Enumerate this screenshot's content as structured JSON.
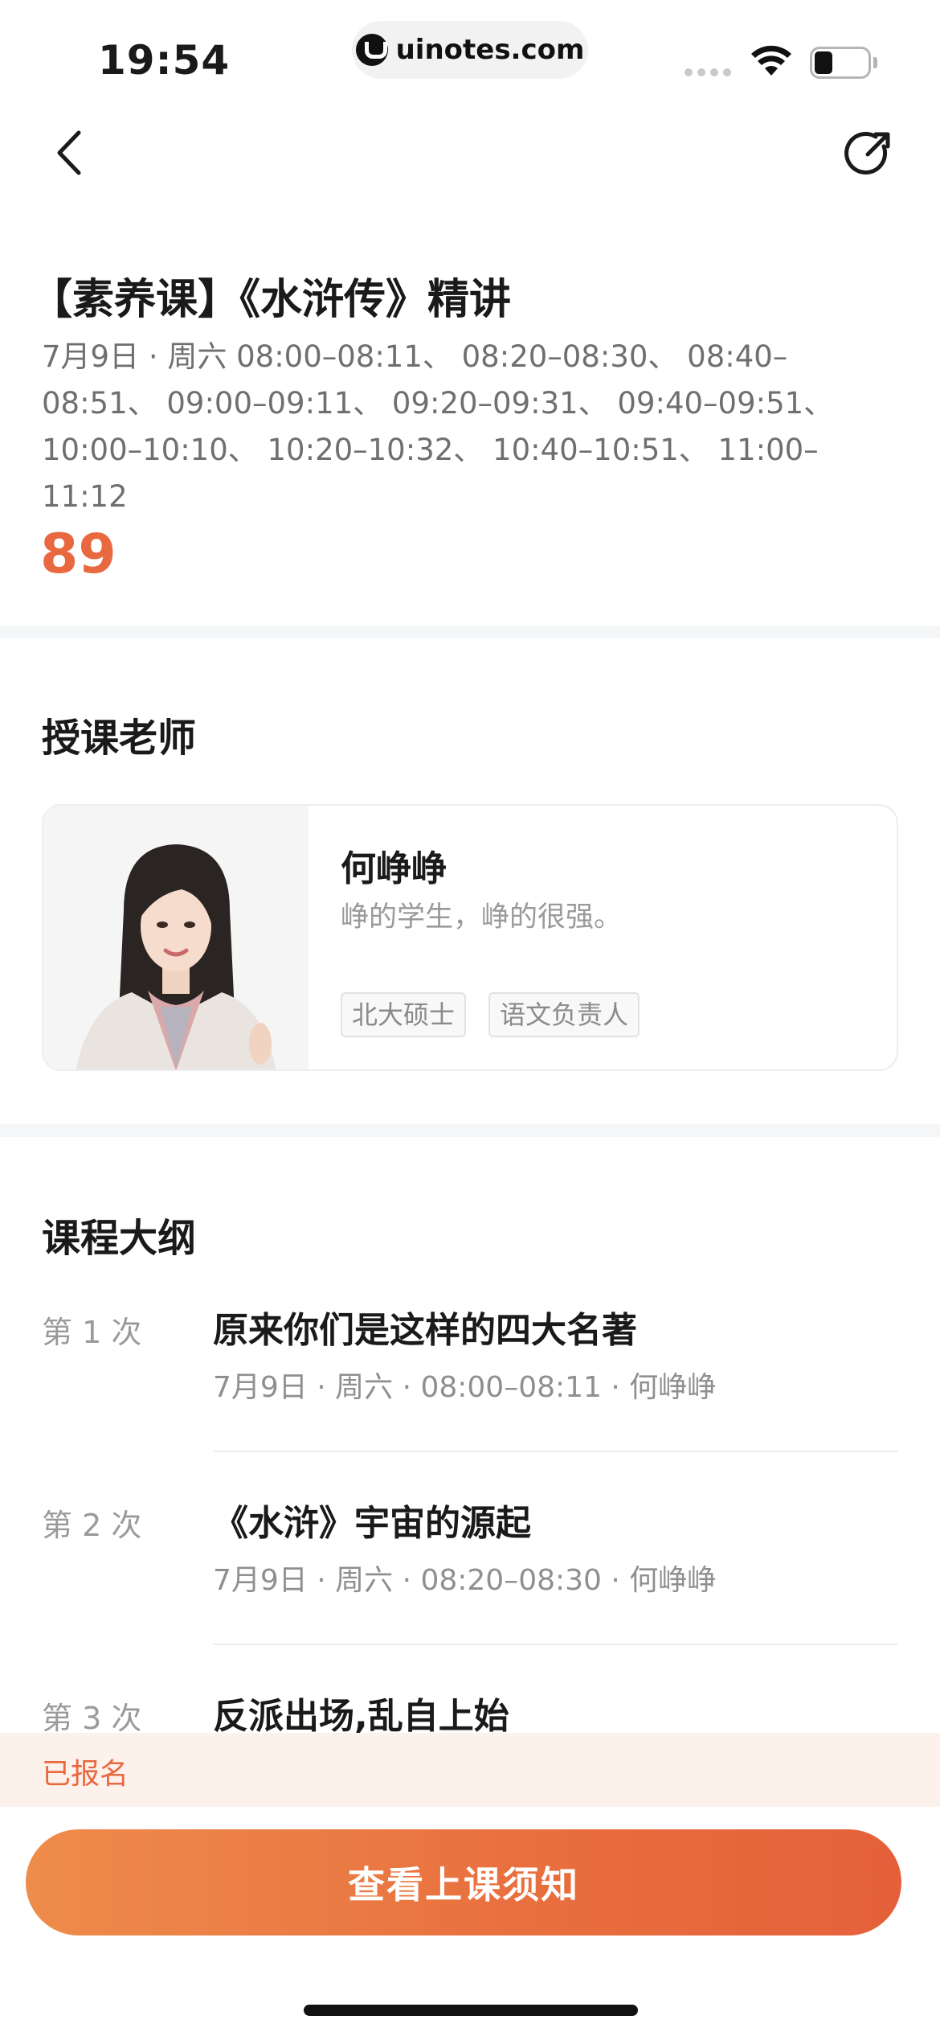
{
  "status_bar": {
    "time": "19:54",
    "url": "uinotes.com",
    "icons": [
      "signal-icon",
      "wifi-icon",
      "battery-icon"
    ]
  },
  "nav": {
    "back_icon": "chevron-left-icon",
    "share_icon": "share-refresh-icon"
  },
  "course": {
    "title": "【素养课】《水浒传》精讲",
    "schedule": "7月9日 · 周六 08:00–08:11、 08:20–08:30、 08:40–08:51、 09:00–09:11、 09:20–09:31、 09:40–09:51、 10:00–10:10、 10:20–10:32、 10:40–10:51、 11:00–11:12",
    "price": "89"
  },
  "teacher_section": {
    "title": "授课老师",
    "name": "何峥峥",
    "bio": "峥的学生，峥的很强。",
    "tags": [
      "北大硕士",
      "语文负责人"
    ]
  },
  "syllabus": {
    "title": "课程大纲",
    "lessons": [
      {
        "index": "第 1 次",
        "title": "原来你们是这样的四大名著",
        "meta": "7月9日 · 周六 · 08:00–08:11 · 何峥峥"
      },
      {
        "index": "第 2 次",
        "title": "《水浒》宇宙的源起",
        "meta": "7月9日 · 周六 · 08:20–08:30 · 何峥峥"
      },
      {
        "index": "第 3 次",
        "title": "反派出场,乱自上始",
        "meta": ""
      }
    ]
  },
  "footer": {
    "enrolled_label": "已报名",
    "cta_label": "查看上课须知"
  },
  "colors": {
    "accent": "#e8683f",
    "cta_gradient_start": "#ee8c4b",
    "cta_gradient_end": "#e5603a",
    "enrolled_bg": "#fdf1ec"
  }
}
